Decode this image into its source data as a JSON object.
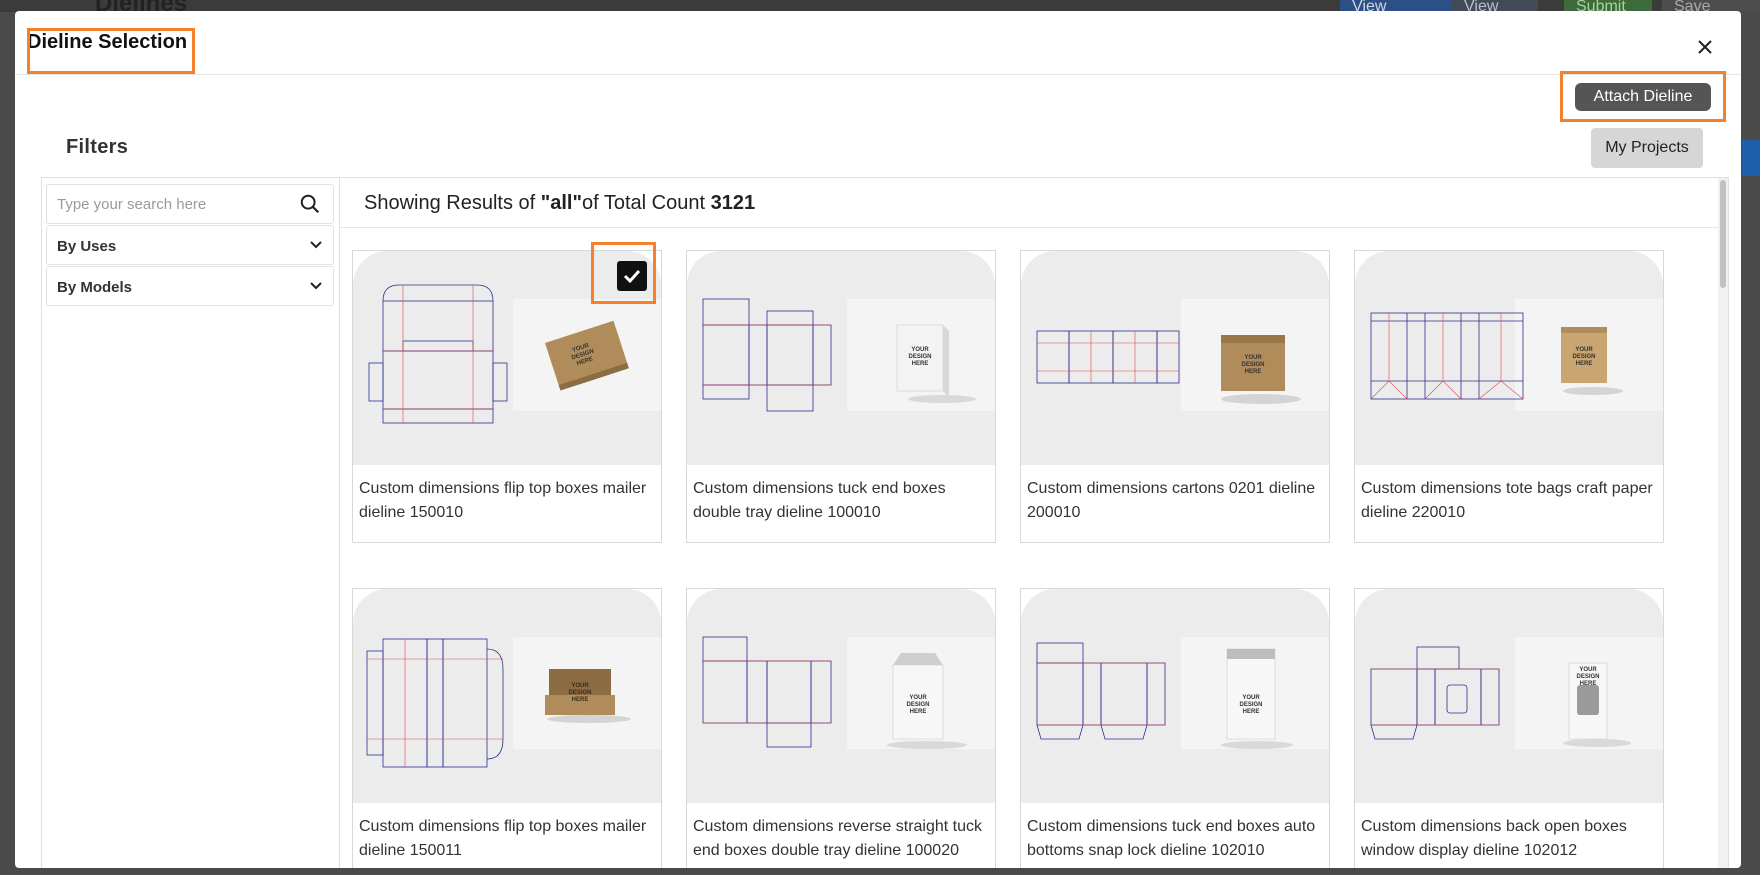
{
  "background": {
    "page_title": "Dielines",
    "buttons": [
      "View Project",
      "View Files",
      "Submit",
      "Save"
    ]
  },
  "modal": {
    "title": "Dieline Selection",
    "close_icon": "close-icon",
    "attach_button": "Attach Dieline",
    "my_projects_button": "My Projects"
  },
  "filters": {
    "heading": "Filters",
    "search_placeholder": "Type your search here",
    "search_icon": "search-icon",
    "accordions": [
      {
        "label": "By Uses",
        "icon": "chevron-down-icon"
      },
      {
        "label": "By Models",
        "icon": "chevron-down-icon"
      }
    ]
  },
  "results": {
    "prefix": "Showing Results of ",
    "query": "\"all\"",
    "middle": "of Total Count ",
    "count": "3121"
  },
  "products": [
    {
      "label": "Custom dimensions flip top boxes mailer dieline 150010",
      "selected": true,
      "mock_text": "YOUR DESIGN HERE"
    },
    {
      "label": "Custom dimensions tuck end boxes double tray dieline 100010",
      "selected": false,
      "mock_text": "YOUR DESIGN HERE"
    },
    {
      "label": "Custom dimensions cartons 0201 dieline 200010",
      "selected": false,
      "mock_text": "YOUR DESIGN HERE"
    },
    {
      "label": "Custom dimensions tote bags craft paper dieline 220010",
      "selected": false,
      "mock_text": "YOUR DESIGN HERE"
    },
    {
      "label": "Custom dimensions flip top boxes mailer dieline 150011",
      "selected": false,
      "mock_text": "YOUR DESIGN HERE"
    },
    {
      "label": "Custom dimensions reverse straight tuck end boxes double tray dieline 100020",
      "selected": false,
      "mock_text": "YOUR DESIGN HERE"
    },
    {
      "label": "Custom dimensions tuck end boxes auto bottoms snap lock dieline 102010",
      "selected": false,
      "mock_text": "YOUR DESIGN HERE"
    },
    {
      "label": "Custom dimensions back open boxes window display dieline 102012",
      "selected": false,
      "mock_text": "YOUR DESIGN HERE"
    }
  ],
  "colors": {
    "highlight": "#f5822a",
    "attach_button_bg": "#555555",
    "dieline_blue": "#2b2f8f",
    "dieline_red": "#e0474c",
    "kraft": "#b08c5a"
  }
}
